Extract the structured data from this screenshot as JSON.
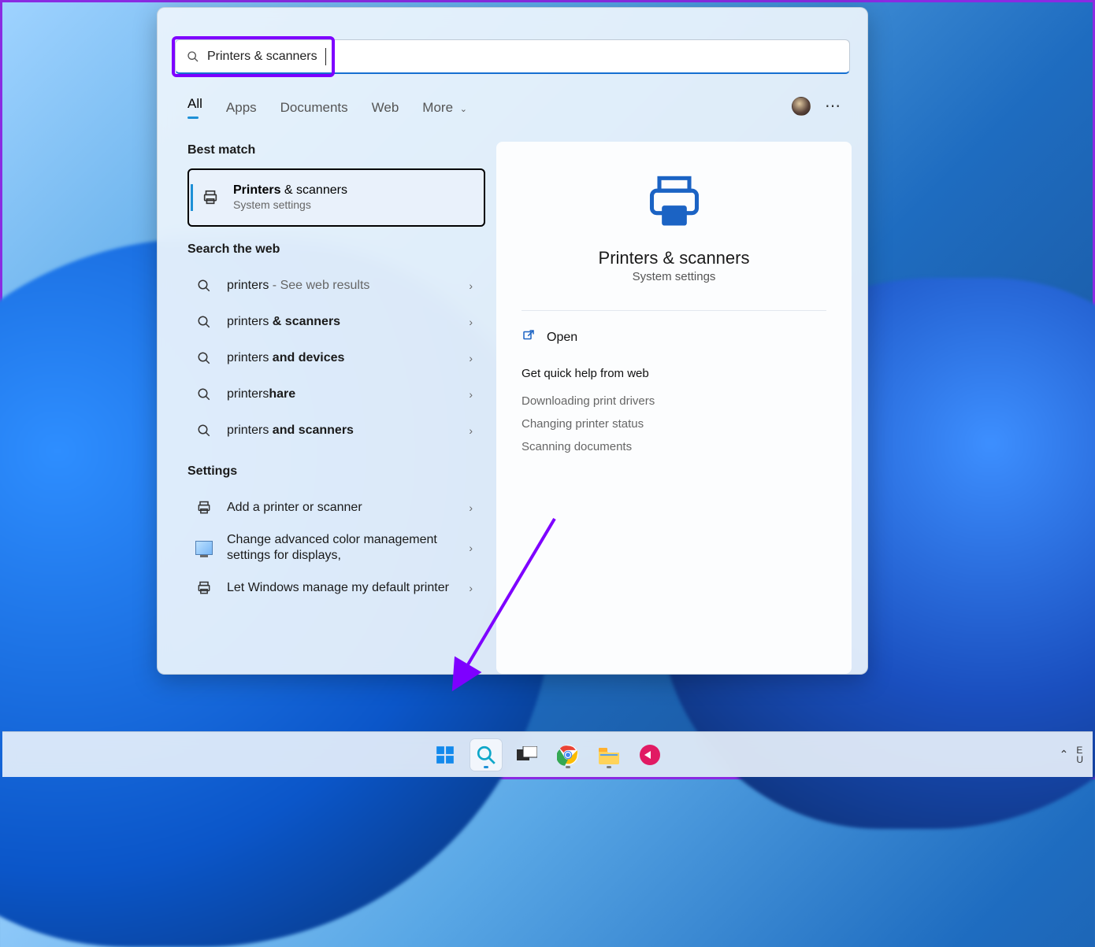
{
  "search": {
    "value": "Printers & scanners"
  },
  "tabs": {
    "all": "All",
    "apps": "Apps",
    "documents": "Documents",
    "web": "Web",
    "more": "More"
  },
  "sections": {
    "best_match": "Best match",
    "search_web": "Search the web",
    "settings": "Settings"
  },
  "best": {
    "title_bold": "Printers",
    "title_rest": " & scanners",
    "subtitle": "System settings"
  },
  "web": [
    {
      "plain": "printers",
      "bold": "",
      "tail": " - See web results"
    },
    {
      "plain": "printers ",
      "bold": "& scanners",
      "tail": ""
    },
    {
      "plain": "printers ",
      "bold": "and devices",
      "tail": ""
    },
    {
      "plain": "printers",
      "bold": "hare",
      "tail": ""
    },
    {
      "plain": "printers ",
      "bold": "and scanners",
      "tail": ""
    }
  ],
  "settings": [
    {
      "label": "Add a printer or scanner",
      "icon": "printer"
    },
    {
      "label": "Change advanced color management settings for displays,",
      "icon": "monitor"
    },
    {
      "label": "Let Windows manage my default printer",
      "icon": "printer"
    }
  ],
  "preview": {
    "title": "Printers & scanners",
    "subtitle": "System settings",
    "open": "Open",
    "help_title": "Get quick help from web",
    "help_links": [
      "Downloading print drivers",
      "Changing printer status",
      "Scanning documents"
    ]
  },
  "tray": {
    "lang1": "E",
    "lang2": "U"
  }
}
